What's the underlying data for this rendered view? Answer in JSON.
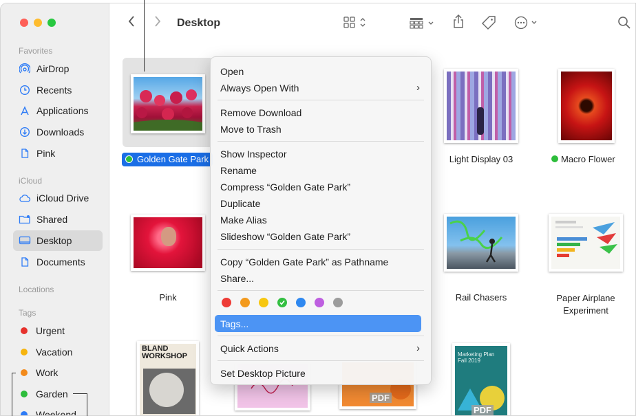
{
  "window": {
    "title": "Desktop"
  },
  "colors": {
    "close": "#fe5f57",
    "minimize": "#febc2e",
    "zoom": "#28c840",
    "accent": "#2e7cf6",
    "selection": "#1a6ee6",
    "menu_highlight": "#4c94f4"
  },
  "sidebar": {
    "favorites_header": "Favorites",
    "favorites": [
      {
        "label": "AirDrop",
        "icon": "airdrop-icon"
      },
      {
        "label": "Recents",
        "icon": "clock-icon"
      },
      {
        "label": "Applications",
        "icon": "applications-icon"
      },
      {
        "label": "Downloads",
        "icon": "download-icon"
      },
      {
        "label": "Pink",
        "icon": "document-icon"
      }
    ],
    "icloud_header": "iCloud",
    "icloud": [
      {
        "label": "iCloud Drive",
        "icon": "cloud-icon"
      },
      {
        "label": "Shared",
        "icon": "shared-folder-icon"
      },
      {
        "label": "Desktop",
        "icon": "desktop-icon",
        "selected": true
      },
      {
        "label": "Documents",
        "icon": "document-icon"
      }
    ],
    "locations_header": "Locations",
    "tags_header": "Tags",
    "tags": [
      {
        "label": "Urgent",
        "color": "#e6312c"
      },
      {
        "label": "Vacation",
        "color": "#f6b40e"
      },
      {
        "label": "Work",
        "color": "#f28a1b"
      },
      {
        "label": "Garden",
        "color": "#2dbd3b"
      },
      {
        "label": "Weekend",
        "color": "#2e7cf6"
      }
    ]
  },
  "files": [
    {
      "name": "Golden Gate Park",
      "selected": true,
      "tag_color": "#2dbd3b"
    },
    {
      "name": "Light Display 03"
    },
    {
      "name": "Macro Flower",
      "tag_color": "#2dbd3b"
    },
    {
      "name": "Pink"
    },
    {
      "name": "Rail Chasers"
    },
    {
      "name": "Paper Airplane Experiment"
    },
    {
      "name": "BLAND WORKSHOP"
    },
    {
      "name": "PDF"
    },
    {
      "name": "Marketing Plan Fall 2019",
      "badge": "PDF"
    }
  ],
  "context_menu": {
    "open": "Open",
    "always_open_with": "Always Open With",
    "remove_download": "Remove Download",
    "move_to_trash": "Move to Trash",
    "show_inspector": "Show Inspector",
    "rename": "Rename",
    "compress": "Compress “Golden Gate Park”",
    "duplicate": "Duplicate",
    "make_alias": "Make Alias",
    "slideshow": "Slideshow “Golden Gate Park”",
    "copy_pathname": "Copy “Golden Gate Park” as Pathname",
    "share": "Share...",
    "tag_colors": [
      "#ee3b36",
      "#f39a1d",
      "#f7c710",
      "#33bf41",
      "#2f88f0",
      "#be5fe0",
      "#9c9c9c"
    ],
    "tags": "Tags...",
    "quick_actions": "Quick Actions",
    "set_desktop_picture": "Set Desktop Picture"
  }
}
